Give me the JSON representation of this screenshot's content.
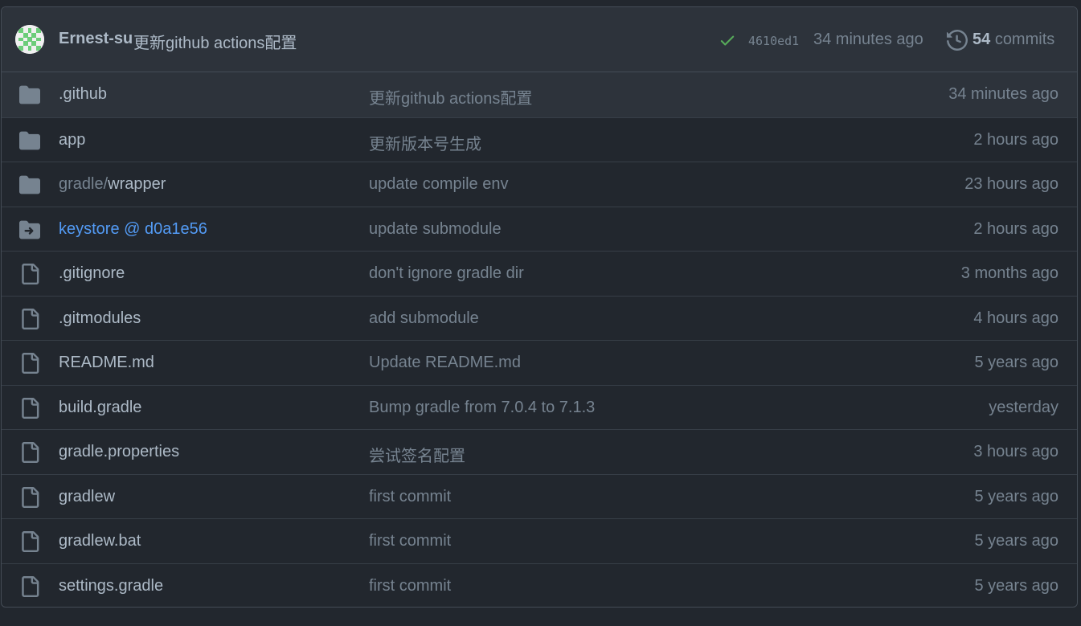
{
  "header": {
    "author": "Ernest-su",
    "message": "更新github actions配置",
    "status_icon": "check-icon",
    "status_color": "#57ab5a",
    "sha": "4610ed1",
    "time": "34 minutes ago",
    "commit_count": "54",
    "commits_label": "commits"
  },
  "colors": {
    "background": "#22272e",
    "header_bg": "#2d333b",
    "border": "#444c56",
    "text": "#adbac7",
    "muted": "#768390",
    "link": "#539bf5"
  },
  "files": [
    {
      "type": "folder",
      "icon": "folder-icon",
      "name": ".github",
      "message": "更新github actions配置",
      "time": "34 minutes ago"
    },
    {
      "type": "folder",
      "icon": "folder-icon",
      "name": "app",
      "message": "更新版本号生成",
      "time": "2 hours ago"
    },
    {
      "type": "folder",
      "icon": "folder-icon",
      "prefix": "gradle/",
      "name": "wrapper",
      "message": "update compile env",
      "time": "23 hours ago"
    },
    {
      "type": "submodule",
      "icon": "submodule-icon",
      "name": "keystore @ d0a1e56",
      "message": "update submodule",
      "time": "2 hours ago"
    },
    {
      "type": "file",
      "icon": "file-icon",
      "name": ".gitignore",
      "message": "don't ignore gradle dir",
      "time": "3 months ago"
    },
    {
      "type": "file",
      "icon": "file-icon",
      "name": ".gitmodules",
      "message": "add submodule",
      "time": "4 hours ago"
    },
    {
      "type": "file",
      "icon": "file-icon",
      "name": "README.md",
      "message": "Update README.md",
      "time": "5 years ago"
    },
    {
      "type": "file",
      "icon": "file-icon",
      "name": "build.gradle",
      "message": "Bump gradle from 7.0.4 to 7.1.3",
      "time": "yesterday"
    },
    {
      "type": "file",
      "icon": "file-icon",
      "name": "gradle.properties",
      "message": "尝试签名配置",
      "time": "3 hours ago"
    },
    {
      "type": "file",
      "icon": "file-icon",
      "name": "gradlew",
      "message": "first commit",
      "time": "5 years ago"
    },
    {
      "type": "file",
      "icon": "file-icon",
      "name": "gradlew.bat",
      "message": "first commit",
      "time": "5 years ago"
    },
    {
      "type": "file",
      "icon": "file-icon",
      "name": "settings.gradle",
      "message": "first commit",
      "time": "5 years ago"
    }
  ]
}
